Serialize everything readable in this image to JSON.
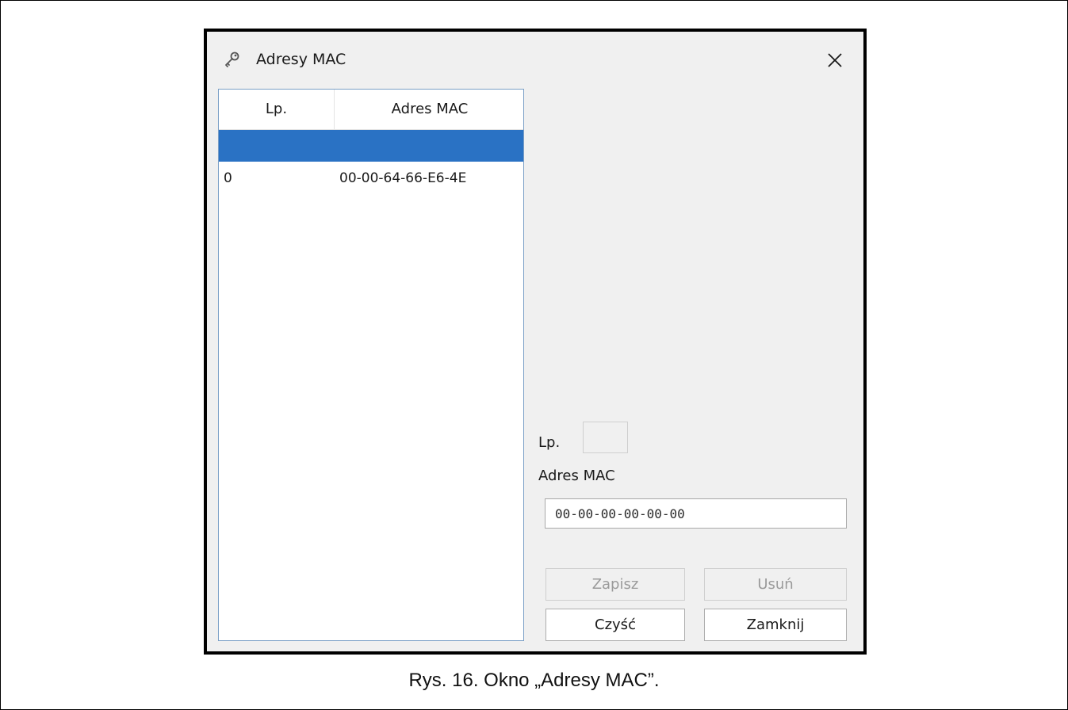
{
  "window": {
    "title": "Adresy MAC",
    "app_icon": "key-icon",
    "close_icon": "close-icon"
  },
  "list": {
    "columns": [
      "Lp.",
      "Adres MAC"
    ],
    "rows": [
      {
        "lp": "0",
        "mac": "00-00-64-66-E6-4E"
      }
    ],
    "selection_color": "#2a72c4"
  },
  "form": {
    "lp_label": "Lp.",
    "lp_value": "",
    "mac_label": "Adres MAC",
    "mac_value": "00-00-00-00-00-00"
  },
  "buttons": {
    "save": "Zapisz",
    "delete": "Usuń",
    "clear": "Czyść",
    "close": "Zamknij"
  },
  "caption": "Rys. 16. Okno „Adresy MAC”."
}
